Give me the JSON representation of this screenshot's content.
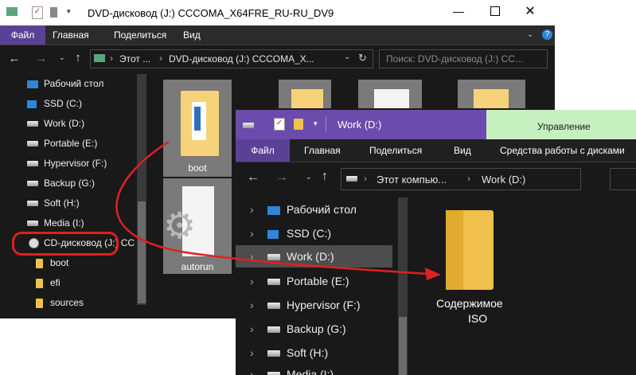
{
  "back_window": {
    "title": "DVD-дисковод (J:) CCCOMA_X64FRE_RU-RU_DV9",
    "tabs": [
      "Файл",
      "Главная",
      "Поделиться",
      "Вид"
    ],
    "address": [
      "Этот ...",
      "DVD-дисковод (J:) CCCOMA_X..."
    ],
    "search_placeholder": "Поиск: DVD-дисковод (J:) CC...",
    "nav": [
      "Рабочий стол",
      "SSD (C:)",
      "Work (D:)",
      "Portable (E:)",
      "Hypervisor (F:)",
      "Backup (G:)",
      "Soft (H:)",
      "Media (I:)",
      "CD-дисковод (J:) CC",
      "boot",
      "efi",
      "sources"
    ],
    "files": [
      "boot",
      "autorun"
    ]
  },
  "front_window": {
    "title": "Work (D:)",
    "manage_tab": "Управление",
    "tabs": [
      "Файл",
      "Главная",
      "Поделиться",
      "Вид",
      "Средства работы с дисками"
    ],
    "address": [
      "Этот компью...",
      "Work (D:)"
    ],
    "nav": [
      "Рабочий стол",
      "SSD (C:)",
      "Work (D:)",
      "Portable (E:)",
      "Hypervisor (F:)",
      "Backup (G:)",
      "Soft (H:)",
      "Media (I:)"
    ],
    "folder_label_1": "Содержимое",
    "folder_label_2": "ISO"
  },
  "colors": {
    "accent": "#5b4196",
    "manage": "#c7f0c0",
    "annotation": "#e02020"
  }
}
